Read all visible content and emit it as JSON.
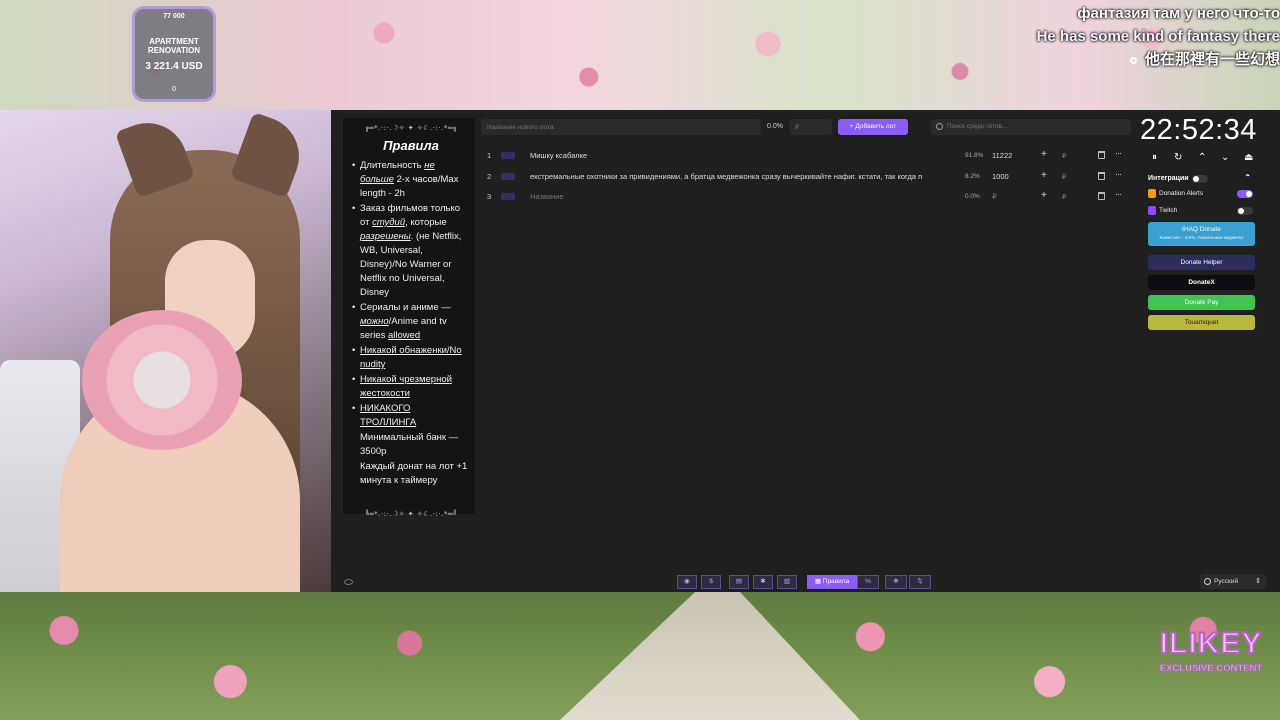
{
  "goal_widget": {
    "top": "77 000",
    "name": "APARTMENT RENOVATION",
    "amount": "3 221.4 USD",
    "bottom": "0"
  },
  "subtitles": {
    "ru": "фантазия там у него что-то",
    "en": "He has some kind of fantasy there",
    "zh": "他在那裡有一些幻想"
  },
  "rules": {
    "ornament_top": "╔═*.·:·.☽✧ ✦ ✧☾.·:·.*═╗",
    "title": "Правила",
    "items": [
      {
        "a": "Длительность ",
        "b": "не больше",
        "c": " 2-х часов/Max length - 2h"
      },
      {
        "a": "Заказ фильмов только от ",
        "b": "студий",
        "c": ", которые ",
        "d": "разрешены",
        "e": ". (не Netflix, WB, Universal, Disney)/No Warner or Netflix no Universal, Disney"
      },
      {
        "a": "Сериалы и аниме — ",
        "b": "можно",
        "c": "/Anime and tv series ",
        "d": "allowed"
      },
      {
        "a": "Никакой обнаженки/No nudity"
      },
      {
        "a": "Никакой чрезмерной жестокости"
      },
      {
        "a": "НИКАКОГО ТРОЛЛИНГА"
      }
    ],
    "plain": [
      "Минимальный банк — 3500р",
      "Каждый донат на лот +1 минута к таймеру"
    ],
    "ornament_bottom": "╚═*.·:·.☽✧ ✦ ✧☾.·:·.*═╝"
  },
  "toolbar": {
    "lot_placeholder": "Название нового лота",
    "percent": "0.0%",
    "amount_placeholder": "₽",
    "add_button": "Добавить лот",
    "search_placeholder": "Поиск среди готов..."
  },
  "lots": [
    {
      "num": "1",
      "name": "Мишку ксабалке",
      "pct": "91.8%",
      "amount": "11222",
      "currency": "₽"
    },
    {
      "num": "2",
      "name": "екстремальные охотники за привидениями, а братца медвежонка сразу вычеркивайте нафиг. кстати, так когда п",
      "pct": "8.2%",
      "amount": "1000",
      "currency": "₽"
    },
    {
      "num": "3",
      "name": "Название",
      "pct": "0.0%",
      "amount": "₽",
      "currency": "₽"
    }
  ],
  "timer": {
    "time": "22:52:34",
    "controls": [
      "⏸",
      "↻",
      "⌃",
      "⌄",
      "⏏"
    ]
  },
  "integrations": {
    "title": "Интеграции",
    "collapse_icon": "⌃",
    "rows": [
      {
        "label": "Donation Alerts",
        "icon_color": "#f59e0b",
        "enabled": true
      },
      {
        "label": "Twitch",
        "icon_color": "#9146ff",
        "enabled": false
      }
    ],
    "services": {
      "ihaq": "IHAQ Donate",
      "ihaq_sub": "Комиссия – 3,5%, Уникальные виджеты!",
      "helper": "Donate Helper",
      "donatex": "DonateX",
      "donatepay": "Donate Pay",
      "tout": "Touamiquet"
    }
  },
  "bottom_bar": {
    "rules_label": "Правила",
    "buttons": [
      "github-icon",
      "dollar-icon",
      "list-icon",
      "bug-icon",
      "stats-icon",
      "rules-icon",
      "percent-icon",
      "move-icon",
      "sort-icon"
    ]
  },
  "language": "Русский",
  "watermark": {
    "big": "ILIKEY",
    "small": "EXCLUSIVE CONTENT"
  }
}
